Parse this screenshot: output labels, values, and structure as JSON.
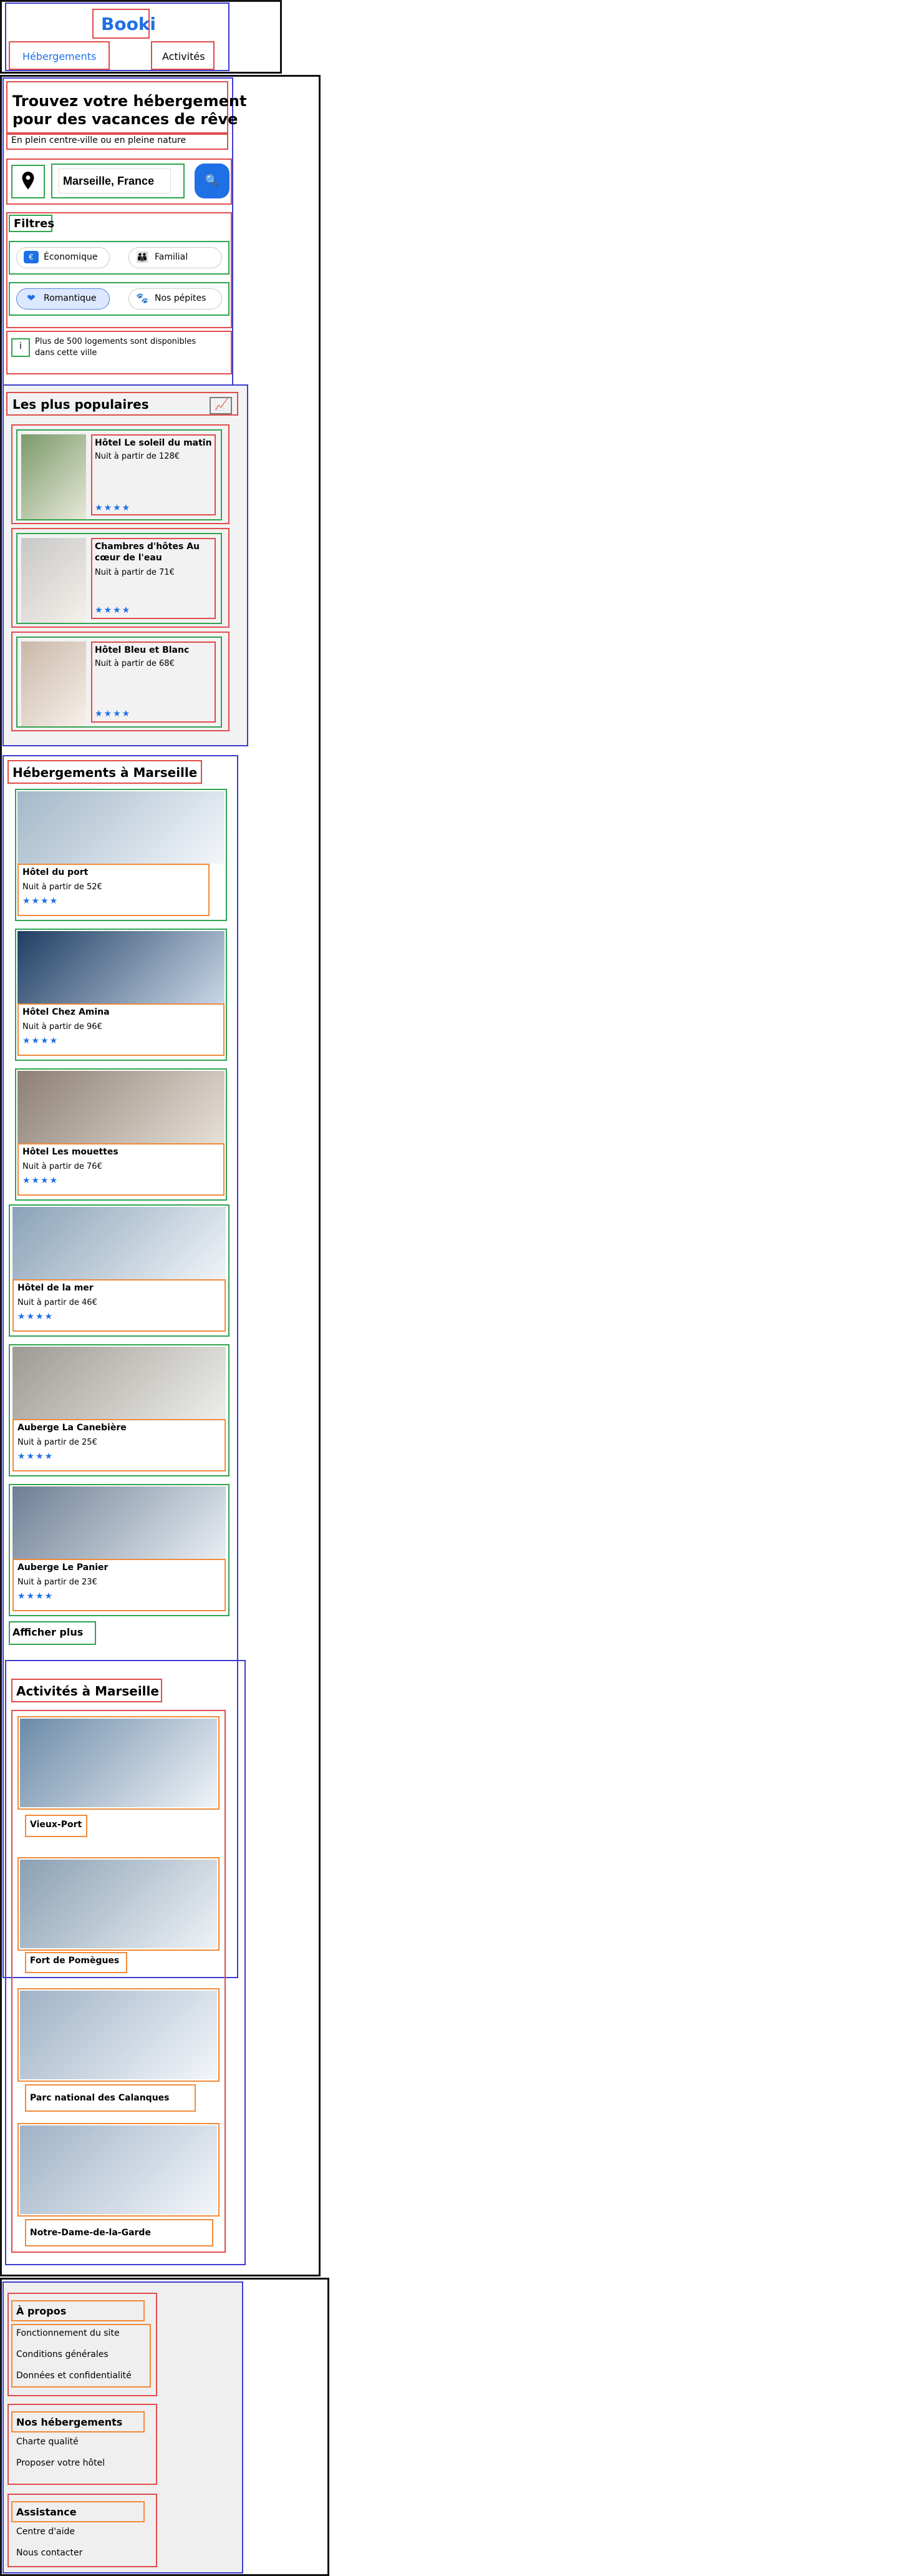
{
  "header": {
    "brand": "Booki",
    "nav": [
      "Hébergements",
      "Activités"
    ]
  },
  "search": {
    "title_line1": "Trouvez votre hébergement",
    "title_line2": "pour des vacances de rêve",
    "subtitle": "En plein centre-ville ou en pleine nature",
    "location_icon": "map-marker-icon",
    "location_value": "Marseille, France",
    "search_icon": "search-icon"
  },
  "filters": {
    "label": "Filtres",
    "items": [
      {
        "label": "Économique",
        "icon": "money-icon",
        "selected": false
      },
      {
        "label": "Familial",
        "icon": "family-icon",
        "selected": false
      },
      {
        "label": "Romantique",
        "icon": "heart-icon",
        "selected": true
      },
      {
        "label": "Nos pépites",
        "icon": "pet-icon",
        "selected": false
      }
    ]
  },
  "info": {
    "icon": "info-icon",
    "text_line1": "Plus de 500 logements sont disponibles",
    "text_line2": "dans cette ville"
  },
  "popular": {
    "title": "Les plus populaires",
    "icon": "chart-icon",
    "items": [
      {
        "name": "Hôtel Le soleil du matin",
        "price": "Nuit à partir de 128€",
        "stars": "★★★★"
      },
      {
        "name_line1": "Chambres d'hôtes Au",
        "name_line2": "cœur de l'eau",
        "price": "Nuit à partir de 71€",
        "stars": "★★★★"
      },
      {
        "name": "Hôtel Bleu et Blanc",
        "price": "Nuit à partir de 68€",
        "stars": "★★★★"
      }
    ]
  },
  "marseille": {
    "title": "Hébergements à Marseille",
    "items": [
      {
        "name": "Hôtel du port",
        "price": "Nuit à partir de 52€",
        "stars": "★★★★"
      },
      {
        "name": "Hôtel Chez Amina",
        "price": "Nuit à partir de 96€",
        "stars": "★★★★"
      },
      {
        "name": "Hôtel Les mouettes",
        "price": "Nuit à partir de 76€",
        "stars": "★★★★"
      },
      {
        "name": "Hôtel de la mer",
        "price": "Nuit à partir de 46€",
        "stars": "★★★★"
      },
      {
        "name": "Auberge La Canebière",
        "price": "Nuit à partir de 25€",
        "stars": "★★★★"
      },
      {
        "name": "Auberge Le Panier",
        "price": "Nuit à partir de 23€",
        "stars": "★★★★"
      }
    ],
    "more": "Afficher plus"
  },
  "activities": {
    "title": "Activités à Marseille",
    "items": [
      "Vieux-Port",
      "Fort de Pomègues",
      "Parc national des Calanques",
      "Notre-Dame-de-la-Garde"
    ]
  },
  "footer": {
    "about": {
      "title": "À propos",
      "links": [
        "Fonctionnement du site",
        "Conditions générales",
        "Données et confidentialité"
      ]
    },
    "hosting": {
      "title": "Nos hébergements",
      "links": [
        "Charte qualité",
        "Proposer votre hôtel"
      ]
    },
    "help": {
      "title": "Assistance",
      "links": [
        "Centre d'aide",
        "Nous contacter"
      ]
    }
  },
  "colors": {
    "brand_blue": "#1f6fe5",
    "frame_black": "#111111",
    "frame_blue": "#3b3bd1",
    "frame_red": "#e24b4b",
    "frame_green": "#2ea44f",
    "frame_orange": "#f08a3a"
  }
}
